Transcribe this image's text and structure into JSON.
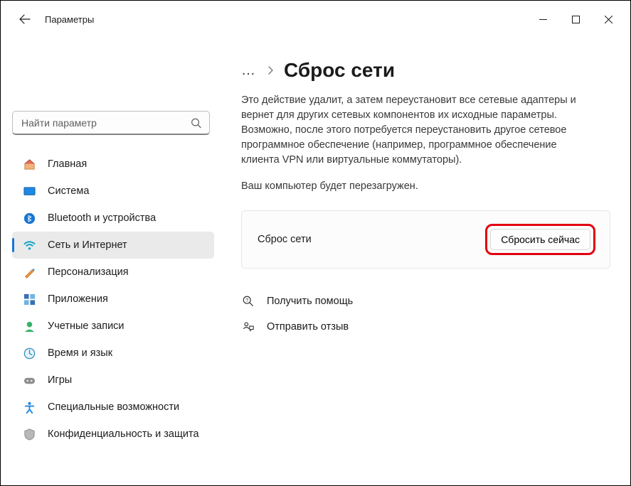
{
  "app": {
    "title": "Параметры"
  },
  "search": {
    "placeholder": "Найти параметр"
  },
  "sidebar": {
    "items": [
      {
        "label": "Главная"
      },
      {
        "label": "Система"
      },
      {
        "label": "Bluetooth и устройства"
      },
      {
        "label": "Сеть и Интернет"
      },
      {
        "label": "Персонализация"
      },
      {
        "label": "Приложения"
      },
      {
        "label": "Учетные записи"
      },
      {
        "label": "Время и язык"
      },
      {
        "label": "Игры"
      },
      {
        "label": "Специальные возможности"
      },
      {
        "label": "Конфиденциальность и защита"
      }
    ]
  },
  "breadcrumb": {
    "ellipsis": "…",
    "title": "Сброс сети"
  },
  "main": {
    "description": "Это действие удалит, а затем переустановит все сетевые адаптеры и вернет для других сетевых компонентов их исходные параметры. Возможно, после этого потребуется переустановить другое сетевое программное обеспечение (например, программное обеспечение клиента VPN или виртуальные коммутаторы).",
    "restart_note": "Ваш компьютер будет перезагружен.",
    "card_label": "Сброс сети",
    "reset_button": "Сбросить сейчас"
  },
  "footer": {
    "help": "Получить помощь",
    "feedback": "Отправить отзыв"
  }
}
